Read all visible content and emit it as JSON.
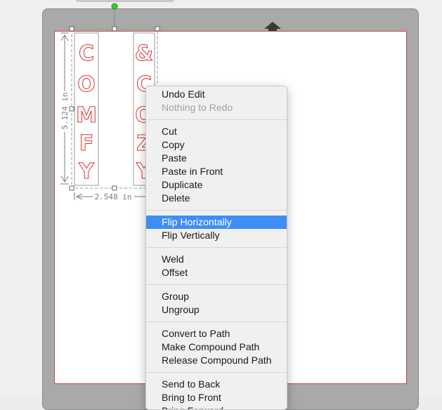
{
  "canvas": {
    "width_dim": "2.548 in",
    "height_dim": "5.124 in",
    "column1_letters": [
      "C",
      "O",
      "M",
      "F",
      "Y"
    ],
    "column2_letters": [
      "&",
      "C",
      "O",
      "Z",
      "Y"
    ]
  },
  "context_menu": {
    "groups": [
      [
        {
          "label": "Undo Edit",
          "enabled": true
        },
        {
          "label": "Nothing to Redo",
          "enabled": false
        }
      ],
      [
        {
          "label": "Cut",
          "enabled": true
        },
        {
          "label": "Copy",
          "enabled": true
        },
        {
          "label": "Paste",
          "enabled": true
        },
        {
          "label": "Paste in Front",
          "enabled": true
        },
        {
          "label": "Duplicate",
          "enabled": true
        },
        {
          "label": "Delete",
          "enabled": true
        }
      ],
      [
        {
          "label": "Flip Horizontally",
          "enabled": true,
          "highlighted": true
        },
        {
          "label": "Flip Vertically",
          "enabled": true
        }
      ],
      [
        {
          "label": "Weld",
          "enabled": true
        },
        {
          "label": "Offset",
          "enabled": true
        }
      ],
      [
        {
          "label": "Group",
          "enabled": true
        },
        {
          "label": "Ungroup",
          "enabled": true
        }
      ],
      [
        {
          "label": "Convert to Path",
          "enabled": true
        },
        {
          "label": "Make Compound Path",
          "enabled": true
        },
        {
          "label": "Release Compound Path",
          "enabled": true
        }
      ],
      [
        {
          "label": "Send to Back",
          "enabled": true
        },
        {
          "label": "Bring to Front",
          "enabled": true
        },
        {
          "label": "Bring Forward",
          "enabled": true
        }
      ]
    ]
  },
  "colors": {
    "menu_highlight": "#3d8ef6",
    "glyph_stroke": "#e0302f",
    "rotate_handle": "#2bd42b"
  }
}
